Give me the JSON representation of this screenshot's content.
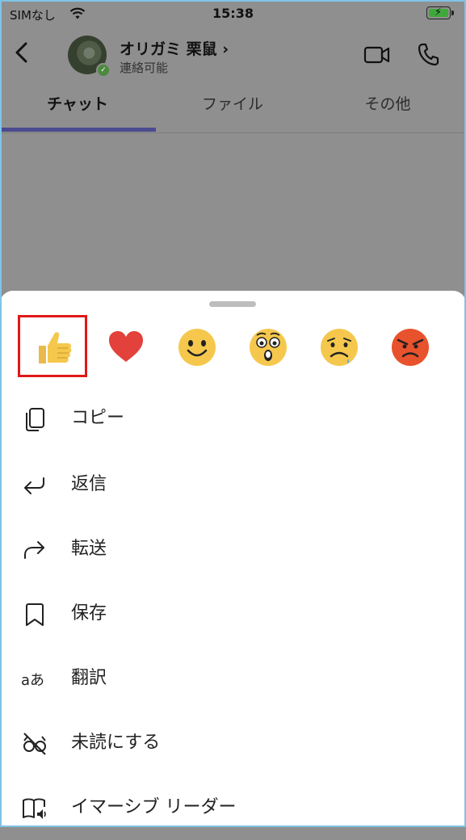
{
  "status_bar": {
    "carrier": "SIMなし",
    "time": "15:38",
    "battery_color": "#3fa83a"
  },
  "header": {
    "contact_name": "オリガミ 栗鼠 ›",
    "contact_status": "連絡可能",
    "status_color": "#4c8a3f",
    "icons": [
      "back-icon",
      "video-call-icon",
      "phone-icon"
    ]
  },
  "tabs": [
    {
      "label": "チャット",
      "active": true
    },
    {
      "label": "ファイル",
      "active": false
    },
    {
      "label": "その他",
      "active": false
    }
  ],
  "reactions": [
    {
      "name": "like",
      "selected": true
    },
    {
      "name": "heart",
      "selected": false
    },
    {
      "name": "laugh",
      "selected": false
    },
    {
      "name": "surprised",
      "selected": false
    },
    {
      "name": "sad",
      "selected": false
    },
    {
      "name": "angry",
      "selected": false
    }
  ],
  "menu": [
    {
      "icon": "copy-icon",
      "label": "コピー"
    },
    {
      "icon": "reply-icon",
      "label": "返信"
    },
    {
      "icon": "forward-icon",
      "label": "転送"
    },
    {
      "icon": "bookmark-icon",
      "label": "保存"
    },
    {
      "icon": "translate-icon",
      "label": "翻訳"
    },
    {
      "icon": "mark-unread-icon",
      "label": "未読にする"
    },
    {
      "icon": "immersive-reader-icon",
      "label": "イマーシブ リーダー"
    }
  ],
  "colors": {
    "accent": "#4a4b8f",
    "highlight_box": "#e01818",
    "overlay": "#8f8f8f"
  }
}
